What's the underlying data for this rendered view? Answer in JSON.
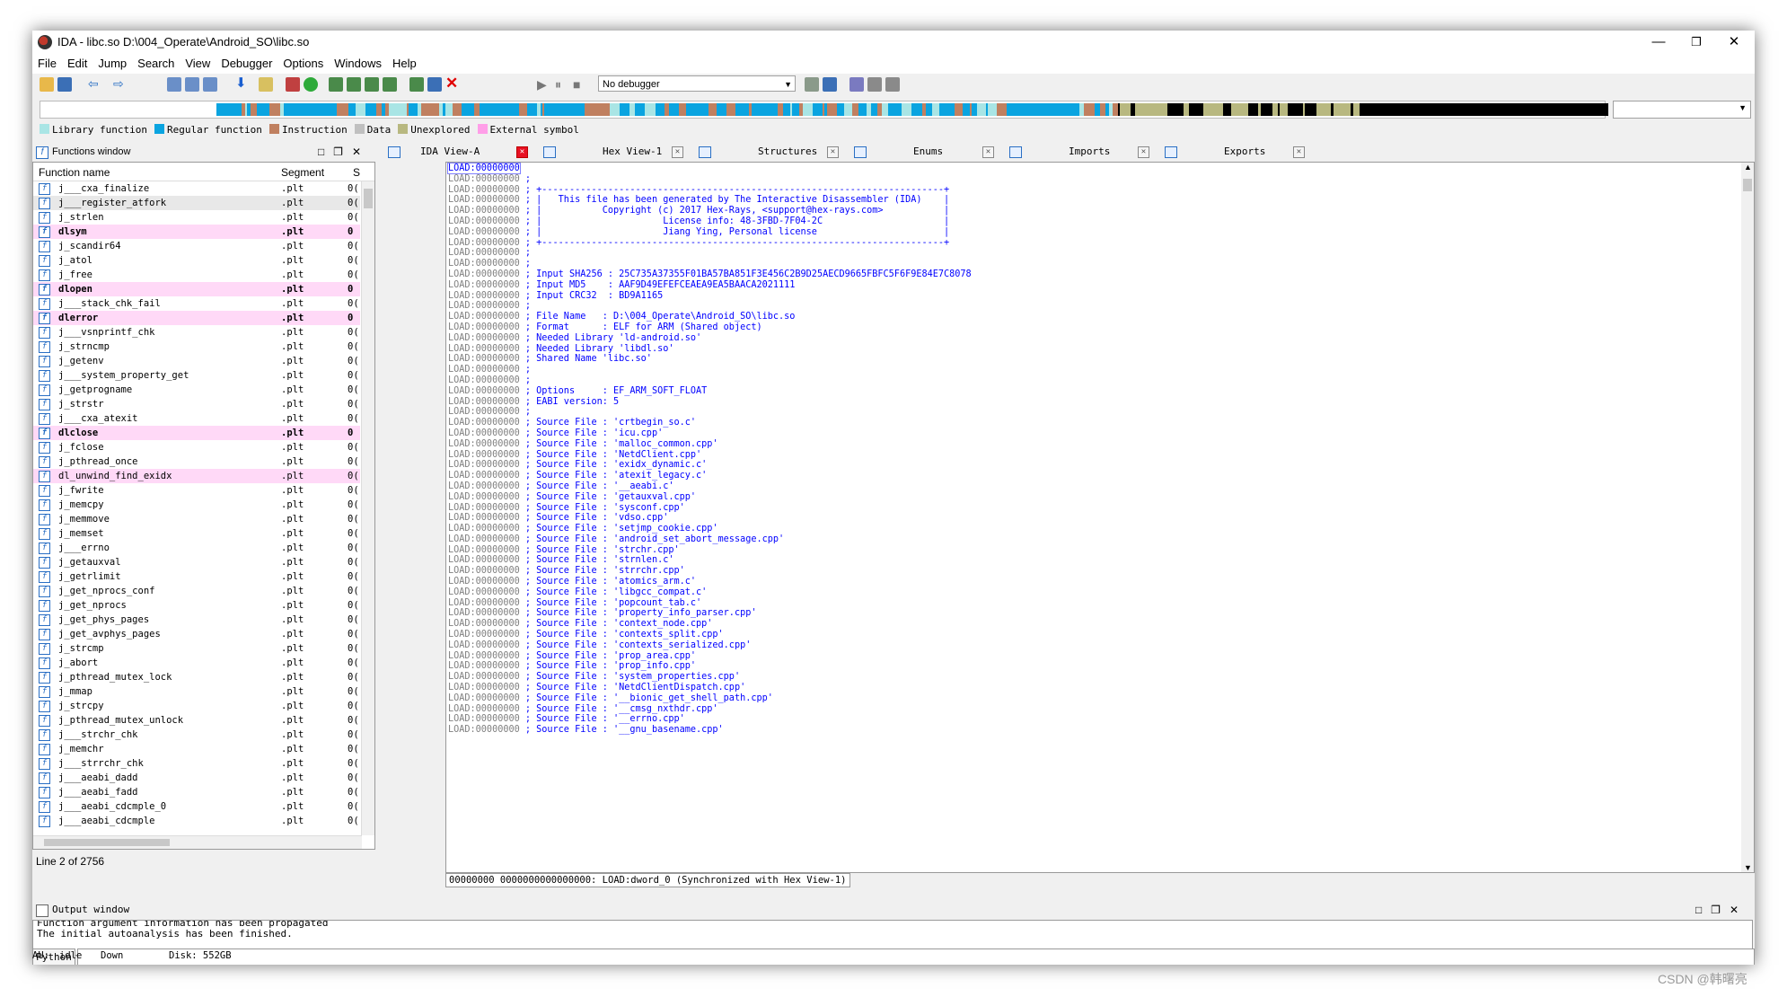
{
  "window": {
    "title": "IDA - libc.so D:\\004_Operate\\Android_SO\\libc.so",
    "minimize": "—",
    "restore": "❐",
    "close": "✕"
  },
  "menu": [
    "File",
    "Edit",
    "Jump",
    "Search",
    "View",
    "Debugger",
    "Options",
    "Windows",
    "Help"
  ],
  "toolbar": {
    "debugger_select": "No debugger"
  },
  "legend": [
    {
      "label": "Library function",
      "color": "#a9e5e5"
    },
    {
      "label": "Regular function",
      "color": "#0aa4e0"
    },
    {
      "label": "Instruction",
      "color": "#c08060"
    },
    {
      "label": "Data",
      "color": "#c0c0c0"
    },
    {
      "label": "Unexplored",
      "color": "#b8b880"
    },
    {
      "label": "External symbol",
      "color": "#ff9ee8"
    }
  ],
  "functions_window": {
    "title": "Functions window",
    "columns": [
      "Function name",
      "Segment",
      "S"
    ],
    "status": "Line 2 of 2756",
    "rows": [
      {
        "name": "j___cxa_finalize",
        "seg": ".plt",
        "s": "0(",
        "kind": "normal"
      },
      {
        "name": "j___register_atfork",
        "seg": ".plt",
        "s": "0(",
        "kind": "sel"
      },
      {
        "name": "j_strlen",
        "seg": ".plt",
        "s": "0(",
        "kind": "normal"
      },
      {
        "name": "dlsym",
        "seg": ".plt",
        "s": "0",
        "kind": "ext"
      },
      {
        "name": "j_scandir64",
        "seg": ".plt",
        "s": "0(",
        "kind": "normal"
      },
      {
        "name": "j_atol",
        "seg": ".plt",
        "s": "0(",
        "kind": "normal"
      },
      {
        "name": "j_free",
        "seg": ".plt",
        "s": "0(",
        "kind": "normal"
      },
      {
        "name": "dlopen",
        "seg": ".plt",
        "s": "0",
        "kind": "ext"
      },
      {
        "name": "j___stack_chk_fail",
        "seg": ".plt",
        "s": "0(",
        "kind": "normal"
      },
      {
        "name": "dlerror",
        "seg": ".plt",
        "s": "0",
        "kind": "ext"
      },
      {
        "name": "j___vsnprintf_chk",
        "seg": ".plt",
        "s": "0(",
        "kind": "normal"
      },
      {
        "name": "j_strncmp",
        "seg": ".plt",
        "s": "0(",
        "kind": "normal"
      },
      {
        "name": "j_getenv",
        "seg": ".plt",
        "s": "0(",
        "kind": "normal"
      },
      {
        "name": "j___system_property_get",
        "seg": ".plt",
        "s": "0(",
        "kind": "normal"
      },
      {
        "name": "j_getprogname",
        "seg": ".plt",
        "s": "0(",
        "kind": "normal"
      },
      {
        "name": "j_strstr",
        "seg": ".plt",
        "s": "0(",
        "kind": "normal"
      },
      {
        "name": "j___cxa_atexit",
        "seg": ".plt",
        "s": "0(",
        "kind": "normal"
      },
      {
        "name": "dlclose",
        "seg": ".plt",
        "s": "0",
        "kind": "ext"
      },
      {
        "name": "j_fclose",
        "seg": ".plt",
        "s": "0(",
        "kind": "normal"
      },
      {
        "name": "j_pthread_once",
        "seg": ".plt",
        "s": "0(",
        "kind": "normal"
      },
      {
        "name": "dl_unwind_find_exidx",
        "seg": ".plt",
        "s": "0(",
        "kind": "ext2"
      },
      {
        "name": "j_fwrite",
        "seg": ".plt",
        "s": "0(",
        "kind": "normal"
      },
      {
        "name": "j_memcpy",
        "seg": ".plt",
        "s": "0(",
        "kind": "normal"
      },
      {
        "name": "j_memmove",
        "seg": ".plt",
        "s": "0(",
        "kind": "normal"
      },
      {
        "name": "j_memset",
        "seg": ".plt",
        "s": "0(",
        "kind": "normal"
      },
      {
        "name": "j___errno",
        "seg": ".plt",
        "s": "0(",
        "kind": "normal"
      },
      {
        "name": "j_getauxval",
        "seg": ".plt",
        "s": "0(",
        "kind": "normal"
      },
      {
        "name": "j_getrlimit",
        "seg": ".plt",
        "s": "0(",
        "kind": "normal"
      },
      {
        "name": "j_get_nprocs_conf",
        "seg": ".plt",
        "s": "0(",
        "kind": "normal"
      },
      {
        "name": "j_get_nprocs",
        "seg": ".plt",
        "s": "0(",
        "kind": "normal"
      },
      {
        "name": "j_get_phys_pages",
        "seg": ".plt",
        "s": "0(",
        "kind": "normal"
      },
      {
        "name": "j_get_avphys_pages",
        "seg": ".plt",
        "s": "0(",
        "kind": "normal"
      },
      {
        "name": "j_strcmp",
        "seg": ".plt",
        "s": "0(",
        "kind": "normal"
      },
      {
        "name": "j_abort",
        "seg": ".plt",
        "s": "0(",
        "kind": "normal"
      },
      {
        "name": "j_pthread_mutex_lock",
        "seg": ".plt",
        "s": "0(",
        "kind": "normal"
      },
      {
        "name": "j_mmap",
        "seg": ".plt",
        "s": "0(",
        "kind": "normal"
      },
      {
        "name": "j_strcpy",
        "seg": ".plt",
        "s": "0(",
        "kind": "normal"
      },
      {
        "name": "j_pthread_mutex_unlock",
        "seg": ".plt",
        "s": "0(",
        "kind": "normal"
      },
      {
        "name": "j___strchr_chk",
        "seg": ".plt",
        "s": "0(",
        "kind": "normal"
      },
      {
        "name": "j_memchr",
        "seg": ".plt",
        "s": "0(",
        "kind": "normal"
      },
      {
        "name": "j___strrchr_chk",
        "seg": ".plt",
        "s": "0(",
        "kind": "normal"
      },
      {
        "name": "j___aeabi_dadd",
        "seg": ".plt",
        "s": "0(",
        "kind": "normal"
      },
      {
        "name": "j___aeabi_fadd",
        "seg": ".plt",
        "s": "0(",
        "kind": "normal"
      },
      {
        "name": "j___aeabi_cdcmple_0",
        "seg": ".plt",
        "s": "0(",
        "kind": "normal"
      },
      {
        "name": "j___aeabi_cdcmple",
        "seg": ".plt",
        "s": "0(",
        "kind": "normal"
      }
    ]
  },
  "tabs": [
    {
      "label": "IDA View-A",
      "active": true
    },
    {
      "label": "Hex View-1",
      "active": false
    },
    {
      "label": "Structures",
      "active": false
    },
    {
      "label": "Enums",
      "active": false
    },
    {
      "label": "Imports",
      "active": false
    },
    {
      "label": "Exports",
      "active": false
    }
  ],
  "ida_view": {
    "address": "LOAD:00000000",
    "status": "00000000 0000000000000000: LOAD:dword_0 (Synchronized with Hex View-1)",
    "lines": [
      "",
      ";",
      "; +-------------------------------------------------------------------------+",
      "; |   This file has been generated by The Interactive Disassembler (IDA)    |",
      "; |           Copyright (c) 2017 Hex-Rays, <support@hex-rays.com>           |",
      "; |                      License info: 48-3FBD-7F04-2C                      |",
      "; |                      Jiang Ying, Personal license                       |",
      "; +-------------------------------------------------------------------------+",
      ";",
      ";",
      "; Input SHA256 : 25C735A37355F01BA57BA851F3E456C2B9D25AECD9665FBFC5F6F9E84E7C8078",
      "; Input MD5    : AAF9D49EFEFCEAEA9EA5BAACA2021111",
      "; Input CRC32  : BD9A1165",
      ";",
      "; File Name   : D:\\004_Operate\\Android_SO\\libc.so",
      "; Format      : ELF for ARM (Shared object)",
      "; Needed Library 'ld-android.so'",
      "; Needed Library 'libdl.so'",
      "; Shared Name 'libc.so'",
      ";",
      ";",
      "; Options     : EF_ARM_SOFT_FLOAT",
      "; EABI version: 5",
      ";",
      "; Source File : 'crtbegin_so.c'",
      "; Source File : 'icu.cpp'",
      "; Source File : 'malloc_common.cpp'",
      "; Source File : 'NetdClient.cpp'",
      "; Source File : 'exidx_dynamic.c'",
      "; Source File : 'atexit_legacy.c'",
      "; Source File : '__aeabi.c'",
      "; Source File : 'getauxval.cpp'",
      "; Source File : 'sysconf.cpp'",
      "; Source File : 'vdso.cpp'",
      "; Source File : 'setjmp_cookie.cpp'",
      "; Source File : 'android_set_abort_message.cpp'",
      "; Source File : 'strchr.cpp'",
      "; Source File : 'strnlen.c'",
      "; Source File : 'strrchr.cpp'",
      "; Source File : 'atomics_arm.c'",
      "; Source File : 'libgcc_compat.c'",
      "; Source File : 'popcount_tab.c'",
      "; Source File : 'property_info_parser.cpp'",
      "; Source File : 'context_node.cpp'",
      "; Source File : 'contexts_split.cpp'",
      "; Source File : 'contexts_serialized.cpp'",
      "; Source File : 'prop_area.cpp'",
      "; Source File : 'prop_info.cpp'",
      "; Source File : 'system_properties.cpp'",
      "; Source File : 'NetdClientDispatch.cpp'",
      "; Source File : '__bionic_get_shell_path.cpp'",
      "; Source File : '__cmsg_nxthdr.cpp'",
      "; Source File : '__errno.cpp'",
      "; Source File : '__gnu_basename.cpp'"
    ]
  },
  "output_window": {
    "title": "Output window",
    "lines": [
      "Function argument information has been propagated",
      "The initial autoanalysis has been finished."
    ],
    "python_button": "Python"
  },
  "statusbar": {
    "au": "AU:",
    "state": "idle",
    "direction": "Down",
    "disk": "Disk: 552GB"
  },
  "watermark": "CSDN @韩曙亮"
}
